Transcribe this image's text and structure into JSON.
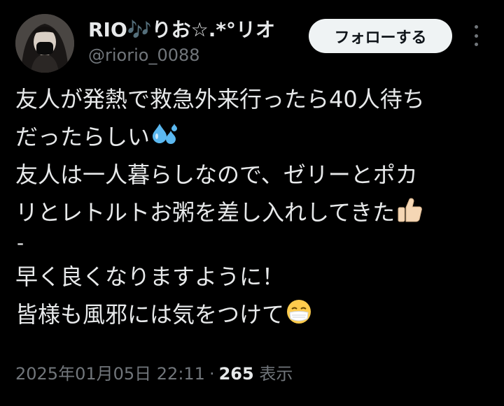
{
  "author": {
    "display_name": "RIO🎶りお☆.*°リオ",
    "handle": "@riorio_0088"
  },
  "follow_button": {
    "label": "フォローする"
  },
  "more_menu": {
    "icon": "more-vertical-icon"
  },
  "tweet": {
    "lines": [
      "友人が発熱で救急外来行ったら40人待ち",
      "だったらしい",
      "友人は一人暮らしなので、ゼリーとポカ",
      "リとレトルトお粥を差し入れしてきた",
      "-",
      "早く良くなりますように！",
      "皆様も風邪には気をつけて"
    ],
    "emojis": {
      "line2": "sweat-droplets-emoji",
      "line4": "thumbs-up-emoji",
      "line7": "mask-face-emoji"
    }
  },
  "meta": {
    "timestamp": "2025年01月05日 22:11",
    "separator": "·",
    "views_count": "265",
    "views_label": "表示"
  },
  "colors": {
    "background": "#000000",
    "text_primary": "#e7e9ea",
    "text_secondary": "#71767b",
    "button_bg": "#eff3f4",
    "button_text": "#0f1419",
    "droplet": "#5bb8f0",
    "thumb": "#f5d7b5"
  }
}
